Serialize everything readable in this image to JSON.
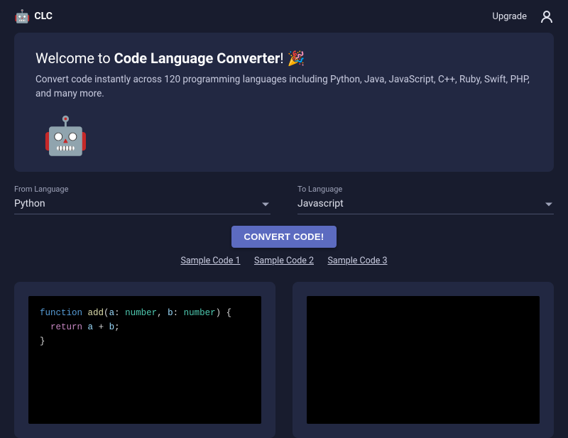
{
  "header": {
    "brand_emoji": "🤖",
    "brand_text": "CLC",
    "upgrade": "Upgrade"
  },
  "welcome": {
    "prefix": "Welcome to ",
    "bold": "Code Language Converter",
    "suffix": "! 🎉",
    "subtitle": "Convert code instantly across 120 programming languages including Python, Java, JavaScript, C++, Ruby, Swift, PHP, and many more.",
    "robot": "🤖"
  },
  "from": {
    "label": "From Language",
    "value": "Python"
  },
  "to": {
    "label": "To Language",
    "value": "Javascript"
  },
  "convert_label": "CONVERT CODE!",
  "samples": [
    "Sample Code 1",
    "Sample Code 2",
    "Sample Code 3"
  ],
  "code": {
    "kw_function": "function",
    "fn_name": "add",
    "p1": "a",
    "p2": "b",
    "type": "number",
    "kw_return": "return",
    "op_plus": "+"
  }
}
